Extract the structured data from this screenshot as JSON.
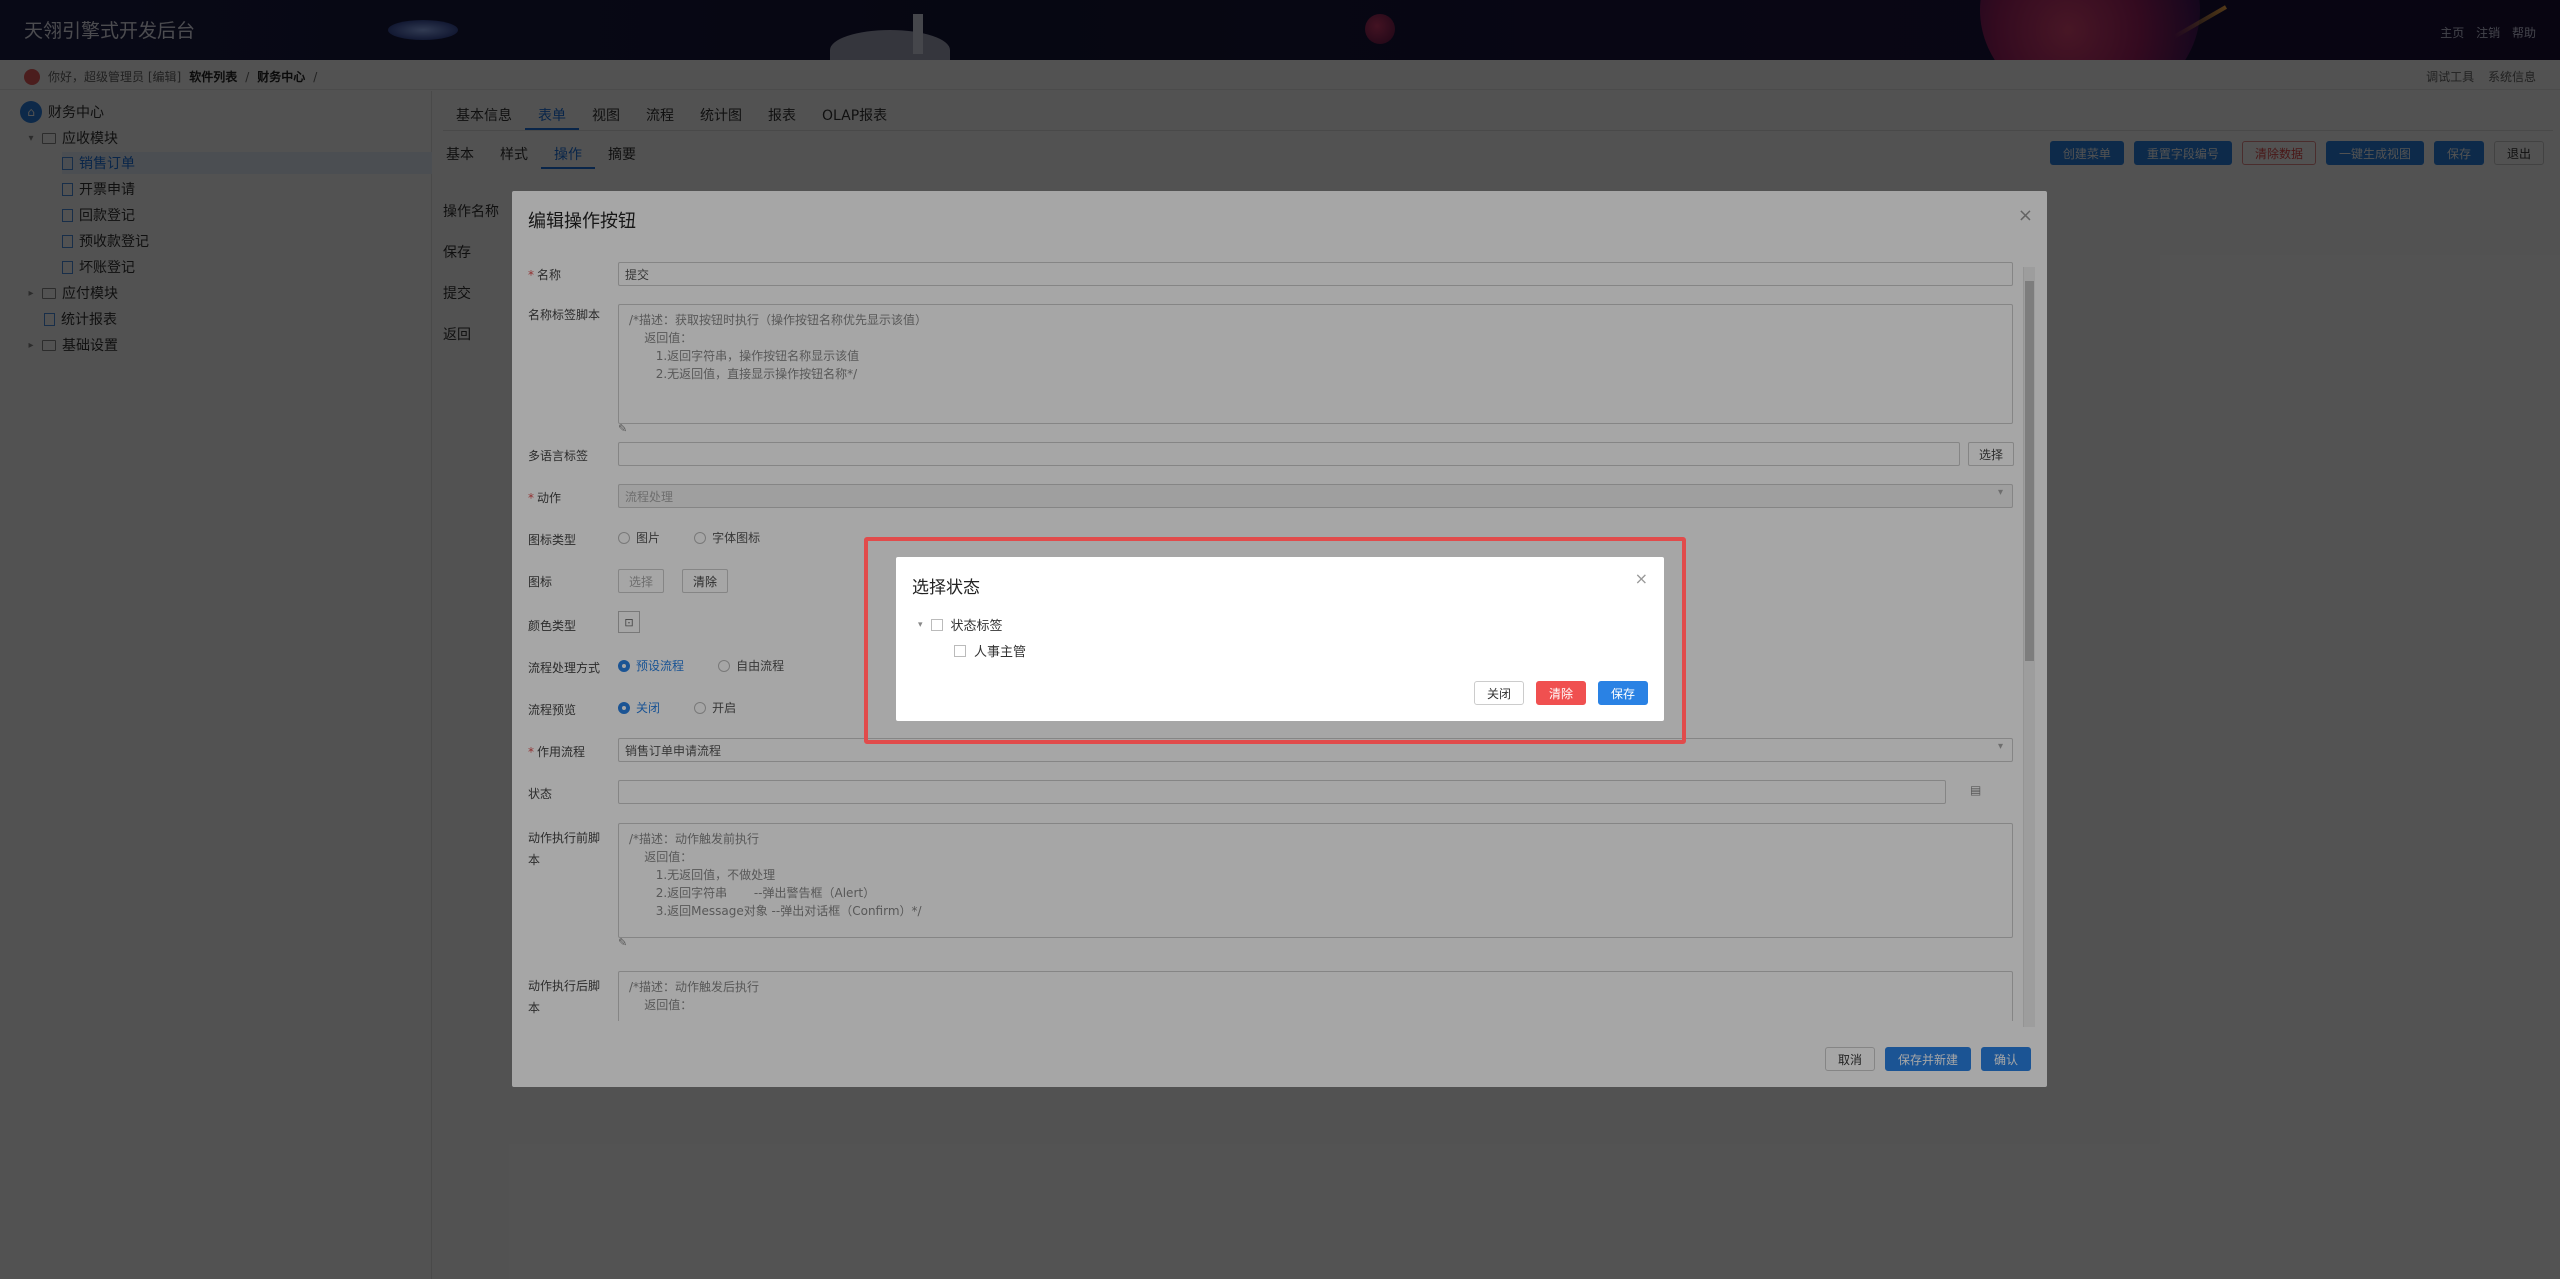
{
  "header": {
    "title": "天翎引擎式开发后台",
    "links": [
      "主页",
      "注销",
      "帮助"
    ]
  },
  "crumbbar": {
    "greeting": "你好，超级管理员 [编辑]",
    "crumb1": "软件列表",
    "sep": "/",
    "crumb2": "财务中心",
    "sep2": "/",
    "right": [
      "调试工具",
      "系统信息"
    ]
  },
  "sidebar": {
    "root": "财务中心",
    "group1": "应收模块",
    "items": [
      "销售订单",
      "开票申请",
      "回款登记",
      "预收款登记",
      "坏账登记"
    ],
    "group2": "应付模块",
    "item_stats": "统计报表",
    "group3": "基础设置"
  },
  "tabs1": [
    "基本信息",
    "表单",
    "视图",
    "流程",
    "统计图",
    "报表",
    "OLAP报表"
  ],
  "tabs2": [
    "基本",
    "样式",
    "操作",
    "摘要"
  ],
  "toolbar": [
    "创建菜单",
    "重置字段编号",
    "清除数据",
    "一键生成视图",
    "保存",
    "退出"
  ],
  "oplist": [
    "操作名称",
    "保存",
    "提交",
    "返回"
  ],
  "dialog": {
    "title": "编辑操作按钮",
    "close": "×",
    "fields": {
      "name_label": "名称",
      "name_value": "提交",
      "script_label": "名称标签脚本",
      "script_value": "/*描述：获取按钮时执行（操作按钮名称优先显示该值）\n    返回值：\n       1.返回字符串，操作按钮名称显示该值\n       2.无返回值，直接显示操作按钮名称*/",
      "lang_label": "多语言标签",
      "lang_btn": "选择",
      "action_label": "动作",
      "action_value": "流程处理",
      "icontype_label": "图标类型",
      "icontype_opt1": "图片",
      "icontype_opt2": "字体图标",
      "icon_label": "图标",
      "icon_btn1": "选择",
      "icon_btn2": "清除",
      "color_label": "颜色类型",
      "flowmode_label": "流程处理方式",
      "flowmode_opt1": "预设流程",
      "flowmode_opt2": "自由流程",
      "preview_label": "流程预览",
      "preview_opt1": "关闭",
      "preview_opt2": "开启",
      "flow_label": "作用流程",
      "flow_value": "销售订单申请流程",
      "state_label": "状态",
      "before_label": "动作执行前脚本",
      "before_value": "/*描述：动作触发前执行\n    返回值：\n       1.无返回值，不做处理\n       2.返回字符串       --弹出警告框（Alert）\n       3.返回Message对象 --弹出对话框（Confirm）*/",
      "after_label": "动作执行后脚本",
      "after_value": "/*描述：动作触发后执行\n    返回值："
    },
    "footer": [
      "取消",
      "保存并新建",
      "确认"
    ]
  },
  "state_dialog": {
    "title": "选择状态",
    "close": "×",
    "root_node": "状态标签",
    "child_node": "人事主管",
    "buttons": [
      "关闭",
      "清除",
      "保存"
    ]
  }
}
